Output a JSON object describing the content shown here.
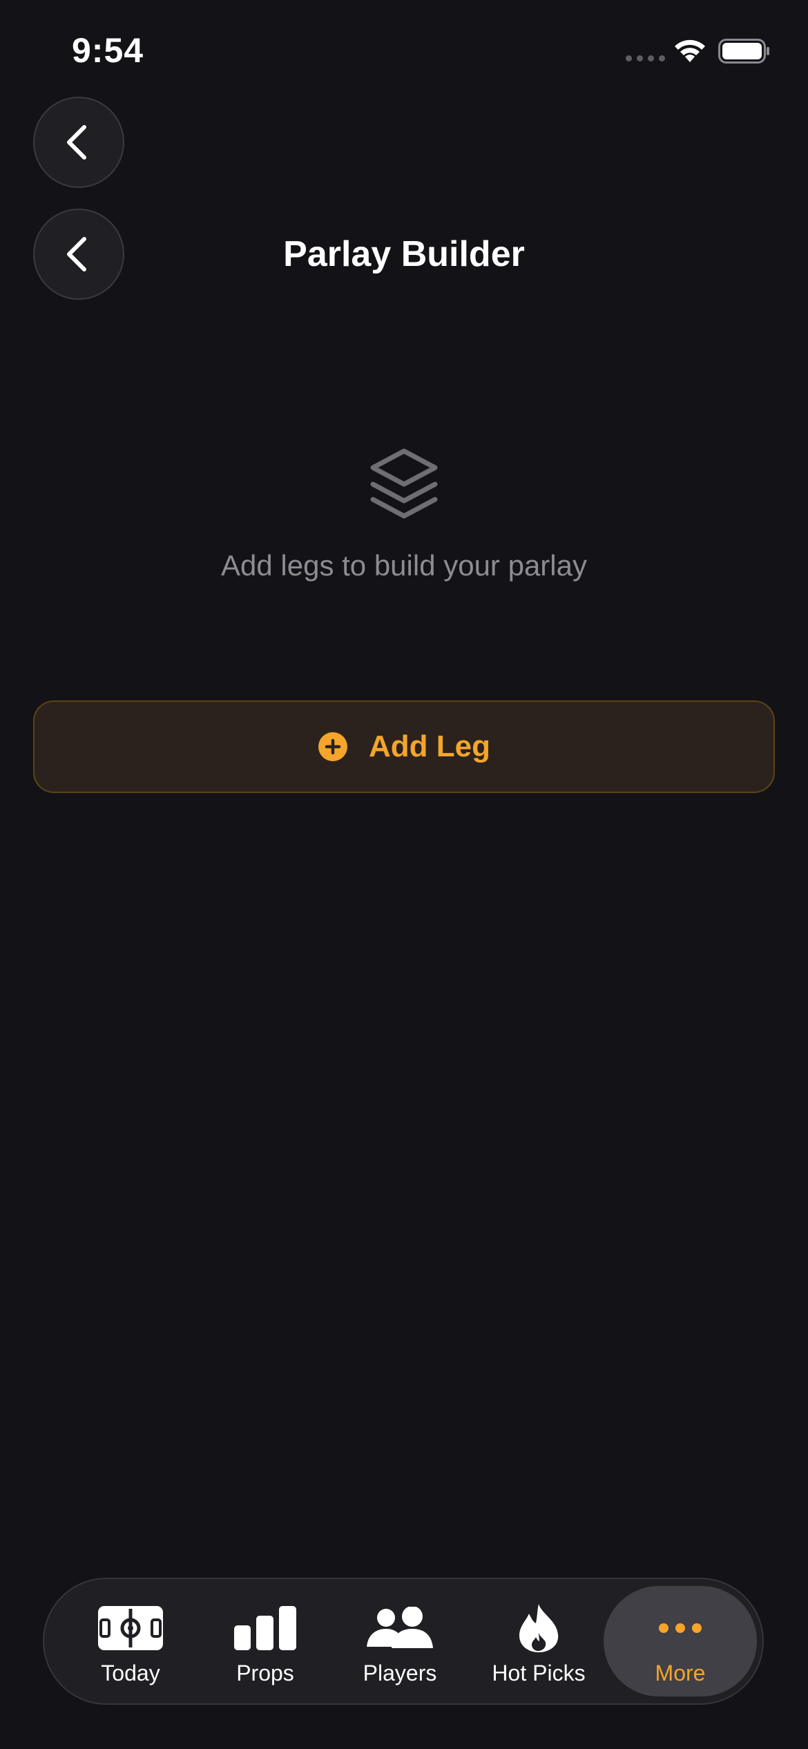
{
  "status_bar": {
    "time": "9:54"
  },
  "header": {
    "title": "Parlay Builder"
  },
  "empty_state": {
    "message": "Add legs to build your parlay",
    "icon": "layers-icon"
  },
  "add_leg": {
    "label": "Add Leg",
    "icon": "plus-circle-icon"
  },
  "tab_bar": {
    "items": [
      {
        "label": "Today",
        "icon": "field-icon"
      },
      {
        "label": "Props",
        "icon": "bar-chart-icon"
      },
      {
        "label": "Players",
        "icon": "people-icon"
      },
      {
        "label": "Hot Picks",
        "icon": "flame-icon"
      },
      {
        "label": "More",
        "icon": "ellipsis-icon",
        "selected": true
      }
    ]
  },
  "colors": {
    "background": "#131317",
    "accent": "#f5a52b",
    "muted_text": "#8c8c94",
    "button_bg": "#2b221d"
  }
}
